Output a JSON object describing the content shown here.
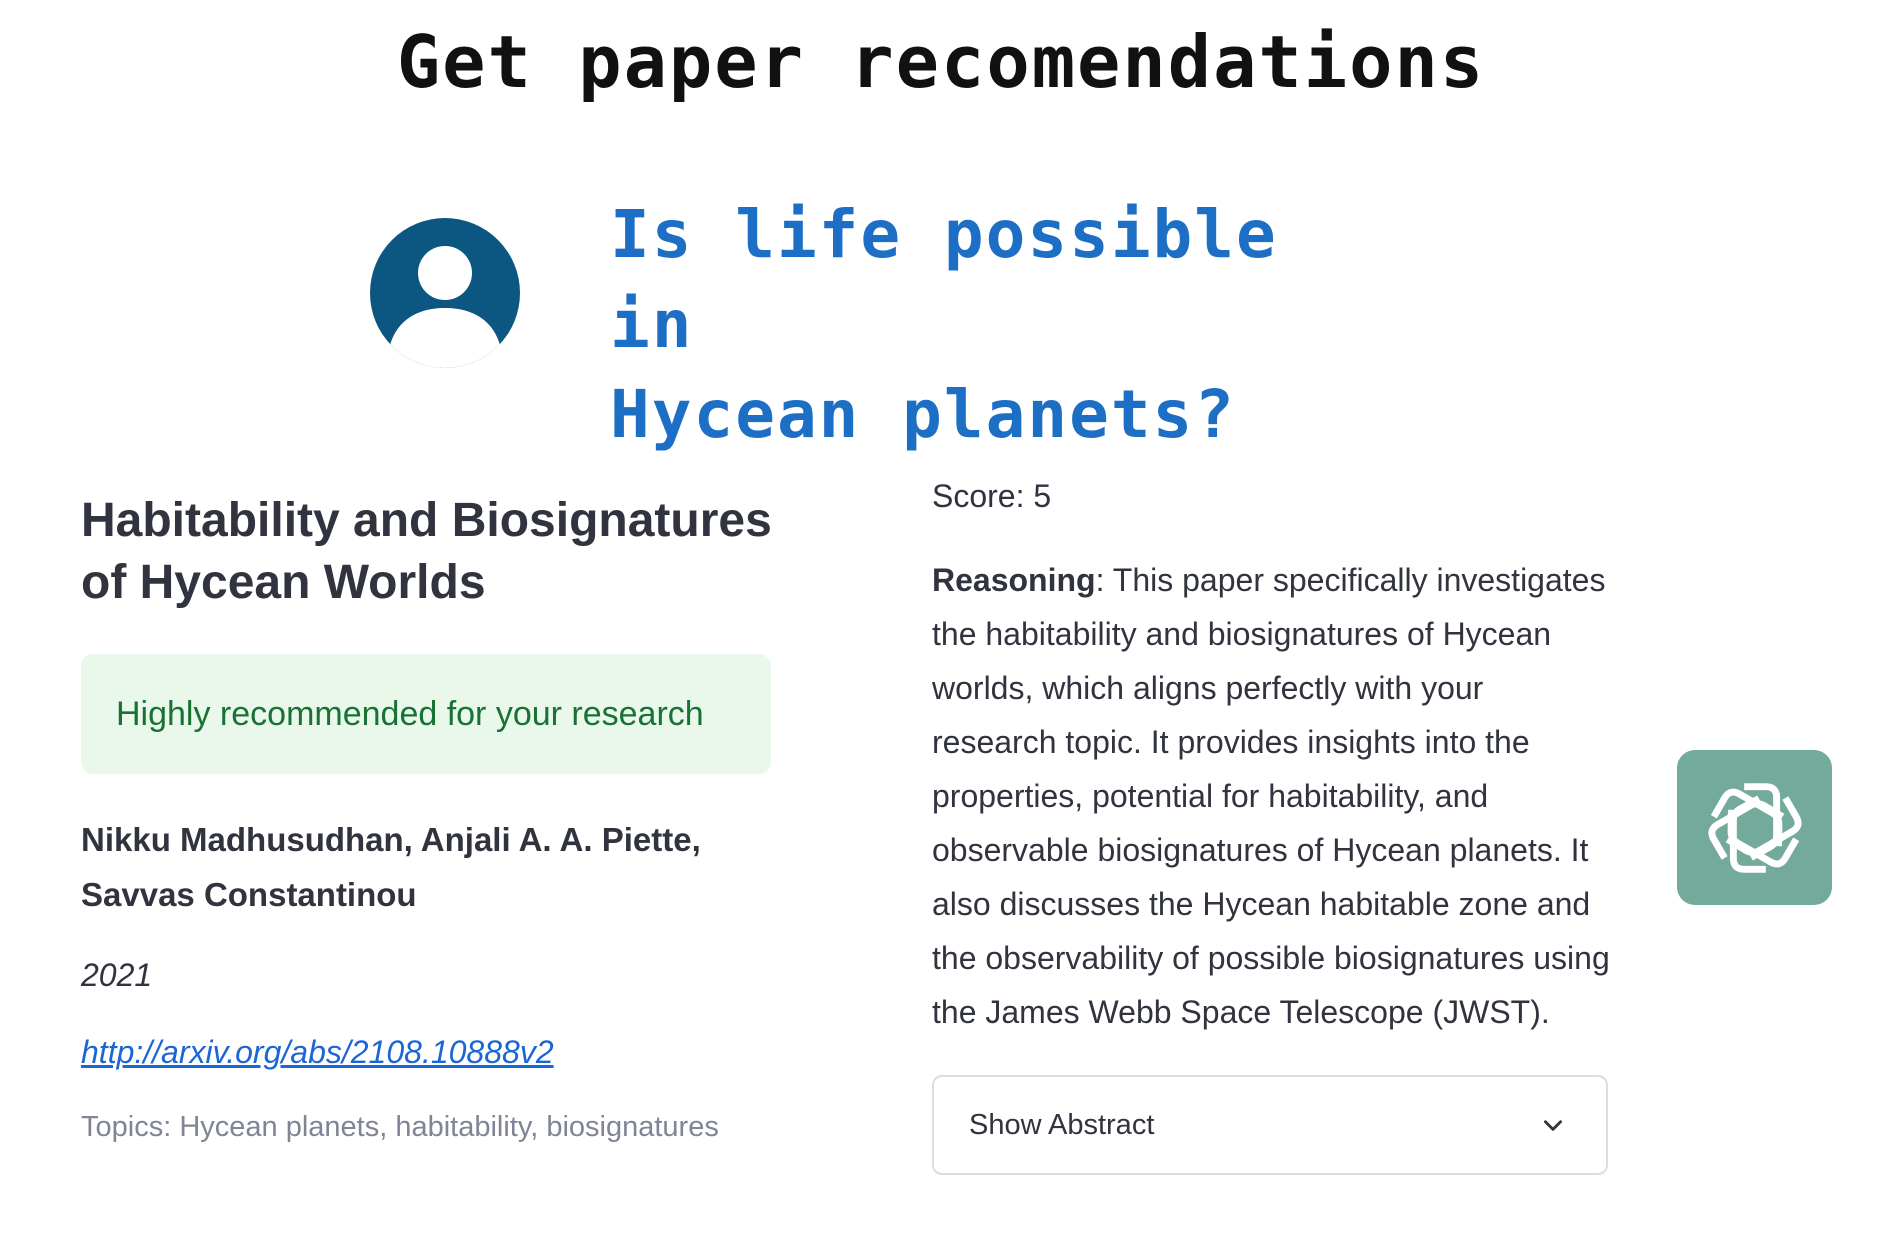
{
  "headline": "Get paper recomendations",
  "user_query": {
    "line1": "Is life possible in",
    "line2": "Hycean planets?"
  },
  "paper": {
    "title": "Habitability and Biosignatures of Hycean Worlds",
    "recommendation": "Highly recommended for your research",
    "authors": "Nikku Madhusudhan, Anjali A. A. Piette, Savvas Constantinou",
    "year": "2021",
    "url": "http://arxiv.org/abs/2108.10888v2",
    "topics": "Topics: Hycean planets, habitability, biosignatures"
  },
  "assessment": {
    "score": "Score: 5",
    "reasoning_label": "Reasoning",
    "reasoning_text": ": This paper specifically investigates the habitability and biosignatures of Hycean worlds, which aligns perfectly with your research topic. It provides insights into the properties, potential for habitability, and observable biosignatures of Hycean planets. It also discusses the Hycean habitable zone and the observability of possible biosignatures using the James Webb Space Telescope (JWST).",
    "expander_label": "Show Abstract"
  },
  "icons": {
    "user": "user-avatar-icon",
    "expander": "chevron-down-icon",
    "assistant": "openai-logo-icon"
  },
  "colors": {
    "query_text": "#1c6fc4",
    "avatar": "#0b5781",
    "recommend_bg": "#eaf8ec",
    "recommend_text": "#177233",
    "link": "#1a66d6",
    "badge": "#74aa9c"
  }
}
